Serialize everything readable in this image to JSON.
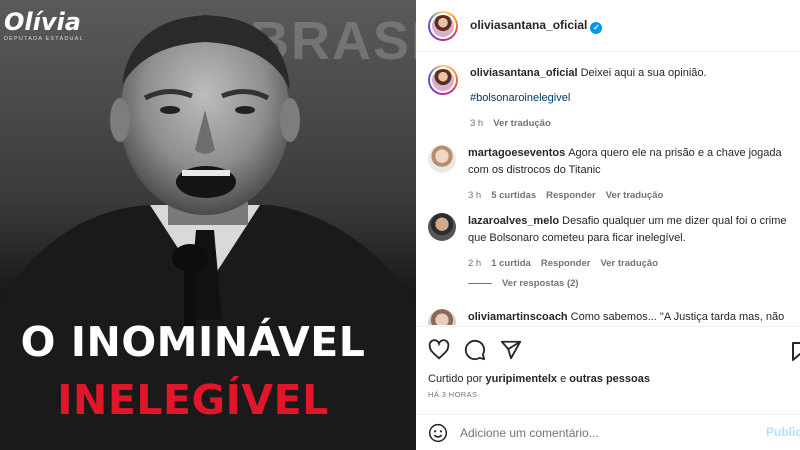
{
  "post_image": {
    "brand_name": "Olívia",
    "brand_subtitle": "DEPUTADA ESTADUAL",
    "background_text": "BRASIL",
    "headline_line1": "O INOMINÁVEL",
    "headline_line2": "INELEGÍVEL",
    "headline2_color": "#e1162a"
  },
  "header": {
    "username": "oliviasantana_oficial"
  },
  "caption": {
    "username": "oliviasantana_oficial",
    "text": "Deixei aqui a sua opinião.",
    "hashtag": "#bolsonaroinelegivel",
    "time": "3 h",
    "translate": "Ver tradução"
  },
  "comments": [
    {
      "username": "martagoeseventos",
      "text": "Agora quero ele na prisão e a chave jogada com os distrocos do Titanic",
      "time": "3 h",
      "likes": "5 curtidas",
      "reply": "Responder",
      "translate": "Ver tradução"
    },
    {
      "username": "lazaroalves_melo",
      "text": "Desafio qualquer um me dizer qual foi o crime que Bolsonaro cometeu para ficar inelegível.",
      "time": "2 h",
      "likes": "1 curtida",
      "reply": "Responder",
      "translate": "Ver tradução"
    },
    {
      "username": "oliviamartinscoach",
      "text": "Como sabemos... \"A Justiça tarda mas, não"
    }
  ],
  "view_replies": "Ver respostas (2)",
  "likes_line": {
    "prefix": "Curtido por",
    "user": "yuripimentelx",
    "middle": "e",
    "others": "outras pessoas"
  },
  "time_ago": "HÁ 3 HORAS",
  "add_comment": {
    "placeholder": "Adicione um comentário...",
    "publish": "Publicar"
  },
  "icons": [
    "heart-icon",
    "comment-icon",
    "share-icon",
    "save-icon",
    "emoji-icon",
    "verified-icon"
  ]
}
